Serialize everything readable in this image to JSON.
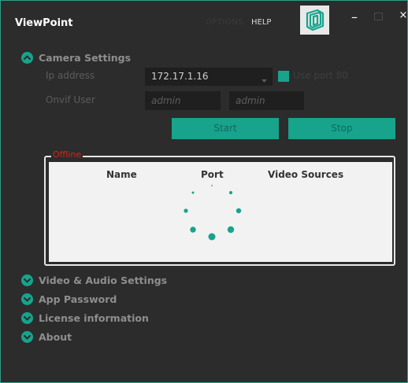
{
  "app": {
    "title": "ViewPoint"
  },
  "menu": {
    "options": "OPTIONS",
    "help": "HELP"
  },
  "window_controls": {
    "minimize": "–",
    "close": "×"
  },
  "icons": {
    "logo": "viewpoint-logo-icon",
    "expand": "chevron-up-icon",
    "collapse": "chevron-down-icon",
    "select": "dropdown-arrow-icon",
    "loading": "loading-spinner-icon"
  },
  "colors": {
    "accent": "#17a38c",
    "background": "#2c2c2c",
    "offline": "#d2241e"
  },
  "camera_settings": {
    "label": "Camera Settings",
    "ip_label": "Ip address",
    "ip_value": "172.17.1.16",
    "use_port_label": "Use port 80",
    "use_port_checked": true,
    "onvif_label": "Onvif User",
    "onvif_user": "admin",
    "onvif_password": "admin",
    "start_label": "Start",
    "stop_label": "Stop"
  },
  "device_list": {
    "status": "Offline",
    "columns": [
      "Name",
      "Port",
      "Video Sources"
    ]
  },
  "sections": [
    {
      "label": "Video & Audio Settings"
    },
    {
      "label": "App Password"
    },
    {
      "label": "License information"
    },
    {
      "label": "About"
    }
  ]
}
